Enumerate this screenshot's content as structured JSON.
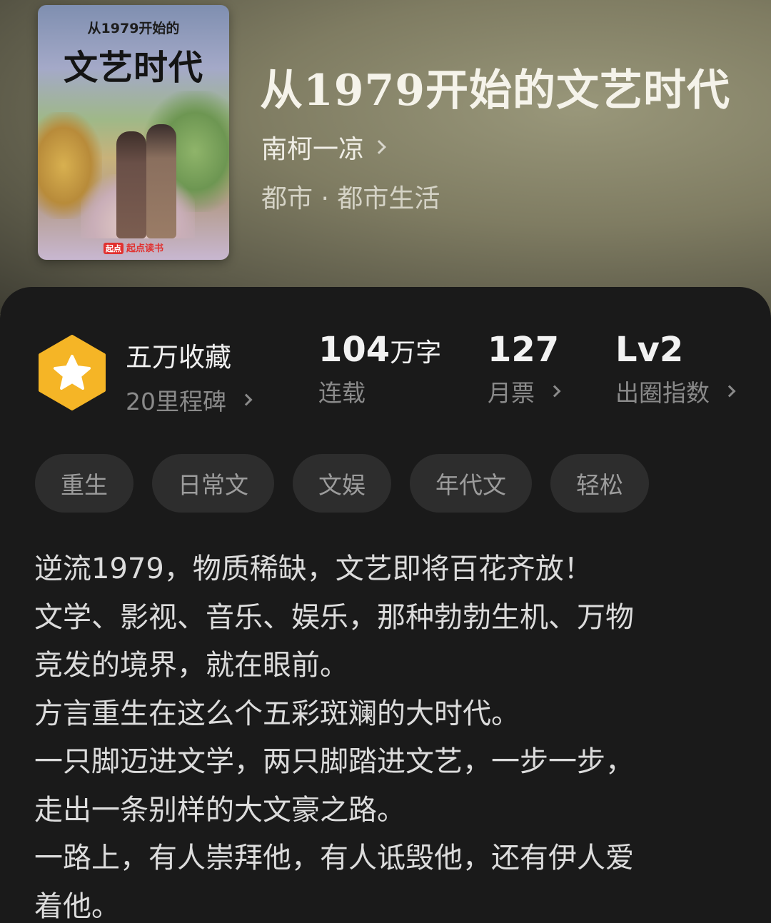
{
  "cover": {
    "small_title": "从1979开始的",
    "big_title": "文艺时代",
    "brand": "起点读书",
    "brand_mark": "起点"
  },
  "book": {
    "title": "从1979开始的文艺时代",
    "author": "南柯一凉",
    "category": "都市 · 都市生活"
  },
  "stats": {
    "collection_title": "五万收藏",
    "collection_sub": "20里程碑",
    "words_num": "104",
    "words_unit": "万字",
    "words_sub": "连载",
    "votes_num": "127",
    "votes_sub": "月票",
    "level_num": "Lv2",
    "level_sub": "出圈指数"
  },
  "tags": [
    "重生",
    "日常文",
    "文娱",
    "年代文",
    "轻松"
  ],
  "description": [
    "逆流1979，物质稀缺，文艺即将百花齐放！",
    "文学、影视、音乐、娱乐，那种勃勃生机、万物",
    "竞发的境界，就在眼前。",
    "方言重生在这么个五彩斑斓的大时代。",
    "一只脚迈进文学，两只脚踏进文艺，一步一步，",
    "走出一条别样的大文豪之路。",
    "一路上，有人崇拜他，有人诋毁他，还有伊人爱",
    "着他。"
  ],
  "colors": {
    "badge": "#f5b526",
    "panel": "#1a1a1a",
    "tag_bg": "#2d2d2d"
  }
}
